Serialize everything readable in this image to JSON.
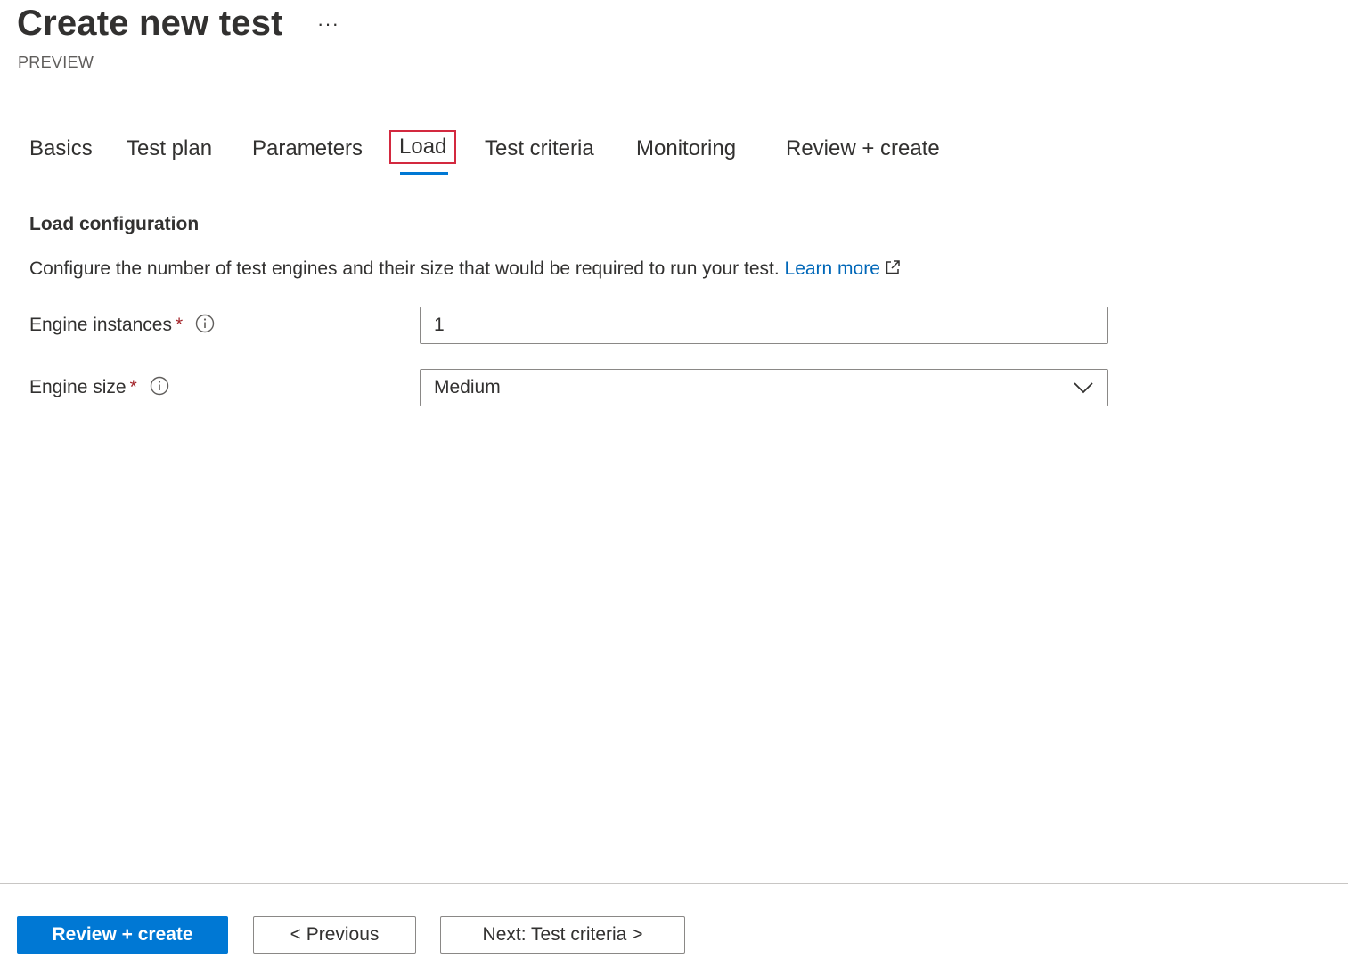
{
  "header": {
    "title": "Create new test",
    "more_label": "···",
    "subtitle": "PREVIEW"
  },
  "tabs": [
    {
      "label": "Basics",
      "active": false
    },
    {
      "label": "Test plan",
      "active": false
    },
    {
      "label": "Parameters",
      "active": false
    },
    {
      "label": "Load",
      "active": true
    },
    {
      "label": "Test criteria",
      "active": false
    },
    {
      "label": "Monitoring",
      "active": false
    },
    {
      "label": "Review + create",
      "active": false
    }
  ],
  "section": {
    "title": "Load configuration",
    "description": "Configure the number of test engines and their size that would be required to run your test.",
    "learn_more": "Learn more"
  },
  "fields": {
    "engine_instances": {
      "label": "Engine instances",
      "required_mark": "*",
      "value": "1"
    },
    "engine_size": {
      "label": "Engine size",
      "required_mark": "*",
      "value": "Medium"
    }
  },
  "footer": {
    "review_create": "Review + create",
    "previous": "< Previous",
    "next": "Next: Test criteria >"
  },
  "colors": {
    "primary": "#0078d4",
    "link": "#0067b8",
    "highlight_box": "#d3293f",
    "required": "#a4262c"
  },
  "icons": [
    "more-icon",
    "external-link-icon",
    "info-icon",
    "chevron-down-icon"
  ]
}
